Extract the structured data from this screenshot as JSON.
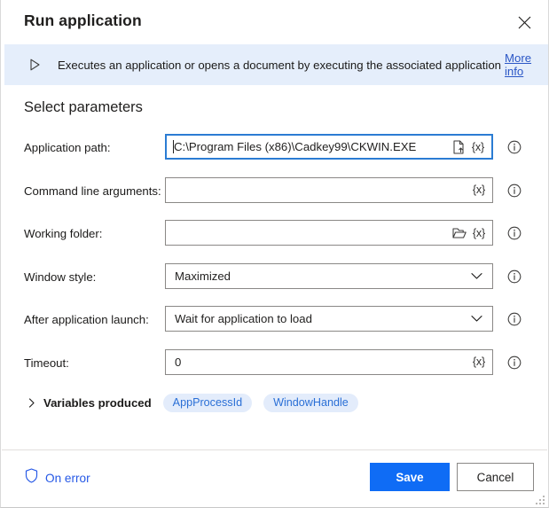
{
  "window": {
    "title": "Run application",
    "close_icon": "close-icon"
  },
  "banner": {
    "icon": "play-triangle-icon",
    "text": "Executes an application or opens a document by executing the associated application",
    "link_label": "More info"
  },
  "main": {
    "section_title": "Select parameters",
    "fields": [
      {
        "label": "Application path:",
        "value": "C:\\Program Files (x86)\\Cadkey99\\CKWIN.EXE",
        "placeholder": "",
        "type": "text",
        "focused": true,
        "has_caret": true,
        "picker_icon": "file-select-icon",
        "variable_token": "{x}",
        "info_icon": "info-icon"
      },
      {
        "label": "Command line arguments:",
        "value": "",
        "placeholder": "",
        "type": "text",
        "focused": false,
        "has_caret": false,
        "picker_icon": "",
        "variable_token": "{x}",
        "info_icon": "info-icon"
      },
      {
        "label": "Working folder:",
        "value": "",
        "placeholder": "",
        "type": "text",
        "focused": false,
        "has_caret": false,
        "picker_icon": "folder-select-icon",
        "variable_token": "{x}",
        "info_icon": "info-icon"
      },
      {
        "label": "Window style:",
        "value": "Maximized",
        "placeholder": "",
        "type": "select",
        "focused": false,
        "has_caret": false,
        "picker_icon": "chevron-down-icon",
        "variable_token": "",
        "info_icon": "info-icon"
      },
      {
        "label": "After application launch:",
        "value": "Wait for application to load",
        "placeholder": "",
        "type": "select",
        "focused": false,
        "has_caret": false,
        "picker_icon": "chevron-down-icon",
        "variable_token": "",
        "info_icon": "info-icon"
      },
      {
        "label": "Timeout:",
        "value": "0",
        "placeholder": "",
        "type": "text",
        "focused": false,
        "has_caret": false,
        "picker_icon": "",
        "variable_token": "{x}",
        "info_icon": "info-icon"
      }
    ],
    "variables_produced": {
      "expander_icon": "chevron-right-icon",
      "label": "Variables produced",
      "pills": [
        "AppProcessId",
        "WindowHandle"
      ]
    }
  },
  "footer": {
    "on_error_icon": "shield-icon",
    "on_error_label": "On error",
    "save_label": "Save",
    "cancel_label": "Cancel"
  },
  "colors": {
    "accent": "#0f6cf5",
    "link": "#2a56c6",
    "banner_bg": "#e5eefb",
    "pill_bg": "#e3ecfb",
    "pill_text": "#2a6fd6",
    "field_border": "#8a8886",
    "focus_border": "#2b7cd3"
  }
}
